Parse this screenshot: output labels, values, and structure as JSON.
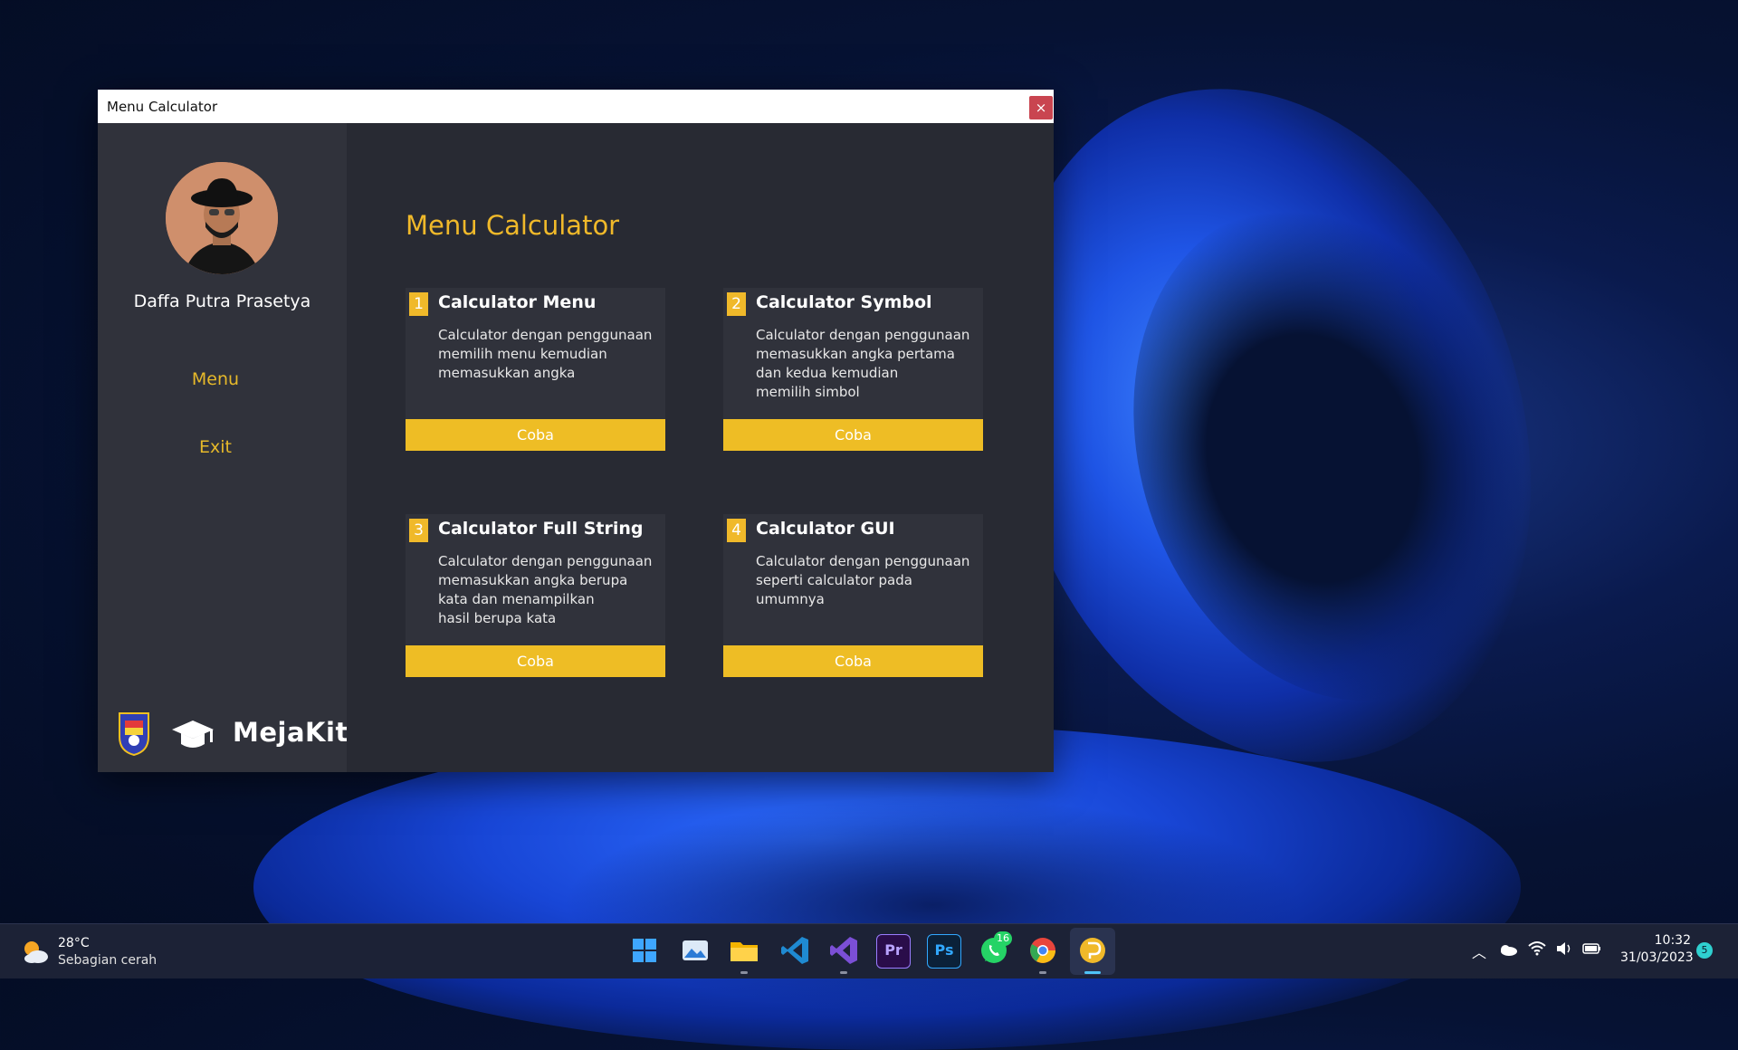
{
  "window": {
    "title": "Menu Calculator",
    "close_glyph": "×"
  },
  "sidebar": {
    "user_name": "Daffa Putra Prasetya",
    "nav": [
      {
        "label": "Menu"
      },
      {
        "label": "Exit"
      }
    ],
    "brand": "MejaKita"
  },
  "main": {
    "title": "Menu Calculator",
    "cards": [
      {
        "num": "1",
        "title": "Calculator Menu",
        "desc": "Calculator dengan penggunaan\nmemilih menu kemudian\nmemasukkan angka",
        "button": "Coba"
      },
      {
        "num": "2",
        "title": "Calculator Symbol",
        "desc": "Calculator dengan penggunaan\nmemasukkan angka pertama\ndan kedua kemudian\nmemilih simbol",
        "button": "Coba"
      },
      {
        "num": "3",
        "title": "Calculator Full String",
        "desc": "Calculator dengan penggunaan\nmemasukkan angka berupa\nkata dan menampilkan\nhasil berupa kata",
        "button": "Coba"
      },
      {
        "num": "4",
        "title": "Calculator GUI",
        "desc": "Calculator dengan penggunaan\nseperti calculator pada\numumnya",
        "button": "Coba"
      }
    ]
  },
  "taskbar": {
    "weather_temp": "28°C",
    "weather_desc": "Sebagian cerah",
    "whatsapp_badge": "16",
    "time": "10:32",
    "date": "31/03/2023",
    "notification_count": "5",
    "pinned": [
      "start-icon",
      "photos-icon",
      "file-explorer-icon",
      "vscode-icon",
      "visual-studio-icon",
      "premiere-pro-icon",
      "photoshop-icon",
      "whatsapp-icon",
      "chrome-icon",
      "java-app-icon"
    ],
    "pinned_labels": {
      "premiere": "Pr",
      "photoshop": "Ps"
    }
  },
  "colors": {
    "accent": "#eebd25",
    "window_bg": "#282a33",
    "sidebar_bg": "#30323b",
    "close": "#c94550"
  }
}
